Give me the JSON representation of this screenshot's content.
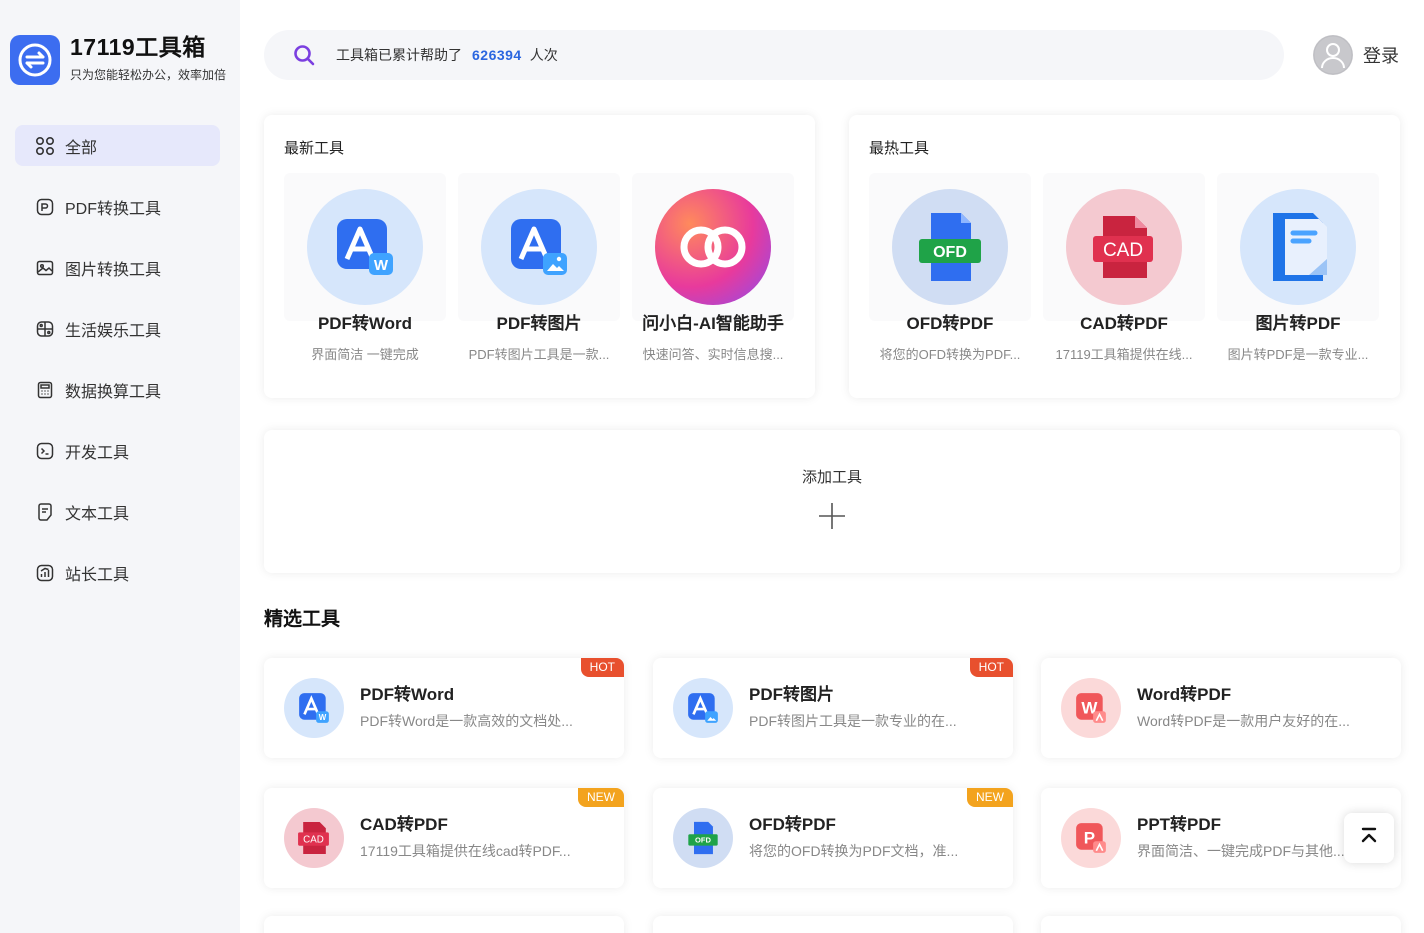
{
  "brand": {
    "name": "17119工具箱",
    "slogan": "只为您能轻松办公，效率加倍"
  },
  "nav": {
    "items": [
      {
        "label": "全部",
        "icon": "grid-icon"
      },
      {
        "label": "PDF转换工具",
        "icon": "pdf-icon"
      },
      {
        "label": "图片转换工具",
        "icon": "image-icon"
      },
      {
        "label": "生活娱乐工具",
        "icon": "gamepad-icon"
      },
      {
        "label": "数据换算工具",
        "icon": "calculator-icon"
      },
      {
        "label": "开发工具",
        "icon": "terminal-icon"
      },
      {
        "label": "文本工具",
        "icon": "text-file-icon"
      },
      {
        "label": "站长工具",
        "icon": "chart-icon"
      }
    ]
  },
  "search": {
    "prefix": "工具箱已累计帮助了",
    "count": "626394",
    "suffix": "人次"
  },
  "user": {
    "login": "登录"
  },
  "latest": {
    "title": "最新工具",
    "tools": [
      {
        "name": "PDF转Word",
        "desc": "界面简洁 一键完成"
      },
      {
        "name": "PDF转图片",
        "desc": "PDF转图片工具是一款..."
      },
      {
        "name": "问小白-AI智能助手",
        "desc": "快速问答、实时信息搜..."
      }
    ]
  },
  "hottest": {
    "title": "最热工具",
    "tools": [
      {
        "name": "OFD转PDF",
        "desc": "将您的OFD转换为PDF..."
      },
      {
        "name": "CAD转PDF",
        "desc": "17119工具箱提供在线..."
      },
      {
        "name": "图片转PDF",
        "desc": "图片转PDF是一款专业..."
      }
    ]
  },
  "add_tool": {
    "label": "添加工具"
  },
  "featured": {
    "title": "精选工具",
    "items": [
      {
        "name": "PDF转Word",
        "desc": "PDF转Word是一款高效的文档处...",
        "badge": "HOT"
      },
      {
        "name": "PDF转图片",
        "desc": "PDF转图片工具是一款专业的在...",
        "badge": "HOT"
      },
      {
        "name": "Word转PDF",
        "desc": "Word转PDF是一款用户友好的在...",
        "badge": ""
      },
      {
        "name": "CAD转PDF",
        "desc": "17119工具箱提供在线cad转PDF...",
        "badge": "NEW"
      },
      {
        "name": "OFD转PDF",
        "desc": "将您的OFD转换为PDF文档，准...",
        "badge": "NEW"
      },
      {
        "name": "PPT转PDF",
        "desc": "界面简洁、一键完成PDF与其他...",
        "badge": ""
      }
    ]
  },
  "icon_text": {
    "ofd": "OFD",
    "cad": "CAD",
    "w": "W",
    "p": "P"
  },
  "colors": {
    "accent": "#2a66e0",
    "brand": "#3c6df0",
    "hot": "#e8502e",
    "new": "#f3a31e",
    "active_nav": "#e6e8fb"
  }
}
